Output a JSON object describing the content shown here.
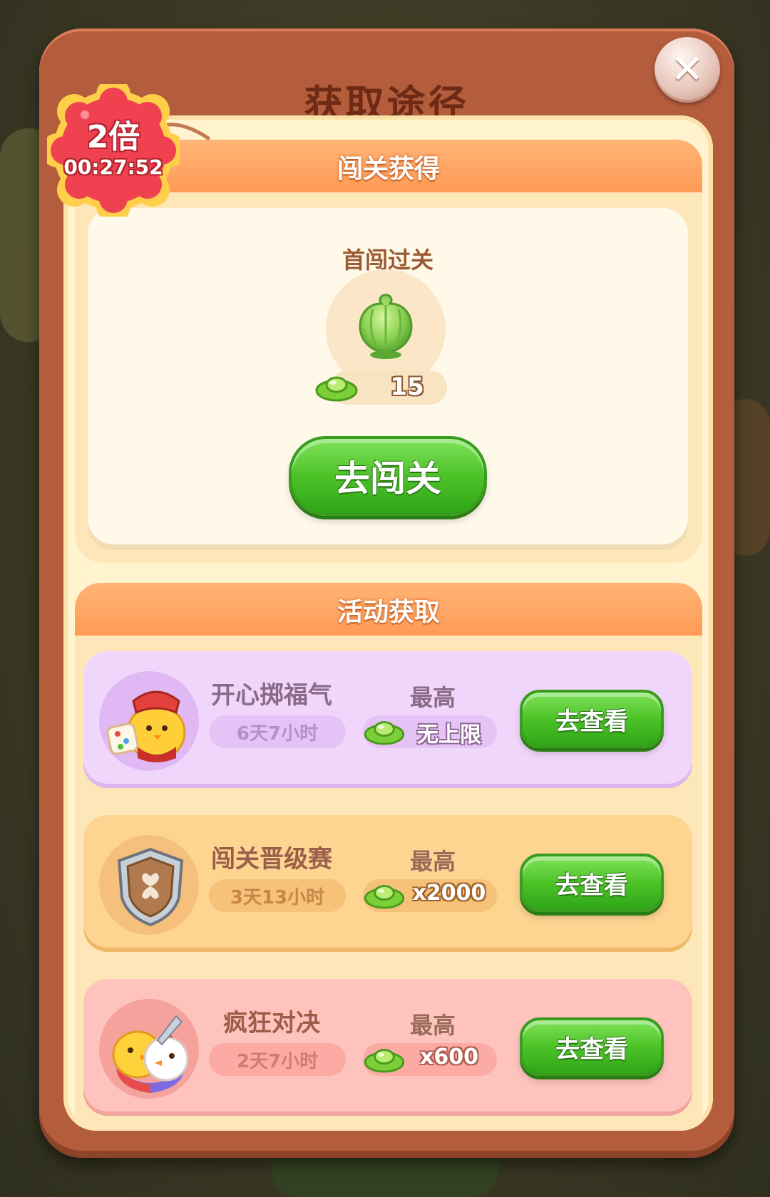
{
  "dialog": {
    "title": "获取途径",
    "close_icon": "close-icon"
  },
  "badge": {
    "multiplier": "2倍",
    "timer": "00:27:52"
  },
  "section_level": {
    "header": "闯关获得",
    "first_clear_label": "首闯过关",
    "reward_item_icon": "cabbage-icon",
    "reward_currency_icon": "gold-ingot-icon",
    "reward_amount": "15",
    "button_label": "去闯关"
  },
  "section_activity": {
    "header": "活动获取",
    "items": [
      {
        "name": "开心掷福气",
        "time_left": "6天7小时",
        "max_label": "最高",
        "reward": "无上限",
        "button_label": "去查看",
        "icon": "chick-dice-icon",
        "theme": "purple"
      },
      {
        "name": "闯关晋级赛",
        "time_left": "3天13小时",
        "max_label": "最高",
        "reward": "x2000",
        "button_label": "去查看",
        "icon": "shield-badge-icon",
        "theme": "orange"
      },
      {
        "name": "疯狂对决",
        "time_left": "2天7小时",
        "max_label": "最高",
        "reward": "x600",
        "button_label": "去查看",
        "icon": "chick-battle-icon",
        "theme": "pink"
      }
    ]
  },
  "colors": {
    "frame": "#b45d3c",
    "cream": "#fff3d0",
    "section_header": "#ff9a55",
    "green_button": "#4dc228",
    "badge_red": "#ef4150"
  }
}
